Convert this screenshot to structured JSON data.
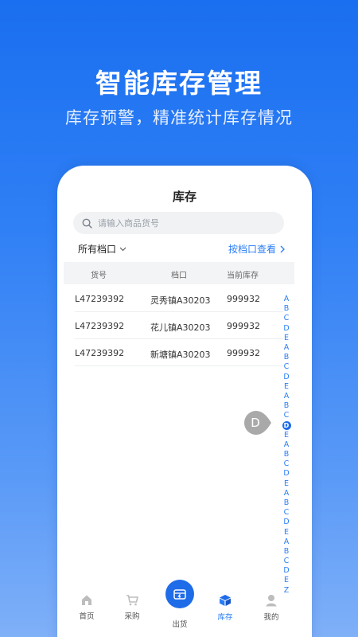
{
  "promo": {
    "title": "智能库存管理",
    "subtitle": "库存预警，精准统计库存情况"
  },
  "screen": {
    "title": "库存",
    "search_placeholder": "请输入商品货号",
    "stall_filter": "所有档口",
    "by_stall_link": "按档口查看",
    "columns": [
      "货号",
      "档口",
      "当前库存"
    ],
    "rows": [
      {
        "sku": "L47239392",
        "stall": "灵秀镇A30203",
        "stock": "999932"
      },
      {
        "sku": "L47239392",
        "stall": "花儿镇A30203",
        "stock": "999932"
      },
      {
        "sku": "L47239392",
        "stall": "新塘镇A30203",
        "stock": "999932"
      }
    ],
    "index_letters": [
      "A",
      "B",
      "C",
      "D",
      "E",
      "A",
      "B",
      "C",
      "D",
      "E",
      "A",
      "B",
      "C",
      "D",
      "E",
      "A",
      "B",
      "C",
      "D",
      "E",
      "A",
      "B",
      "C",
      "D",
      "E",
      "A",
      "B",
      "C",
      "D",
      "E",
      "Z"
    ],
    "active_index": 13,
    "bubble_letter": "D"
  },
  "tabbar": {
    "items": [
      {
        "label": "首页",
        "icon": "home-icon"
      },
      {
        "label": "采购",
        "icon": "cart-icon"
      },
      {
        "label": "出货",
        "icon": "shipment-icon"
      },
      {
        "label": "库存",
        "icon": "inventory-box-icon"
      },
      {
        "label": "我的",
        "icon": "profile-icon"
      }
    ],
    "active": "库存"
  },
  "colors": {
    "accent": "#2a7ef5",
    "primary_button": "#1f6ce8",
    "background_top": "#1a6ff0"
  }
}
